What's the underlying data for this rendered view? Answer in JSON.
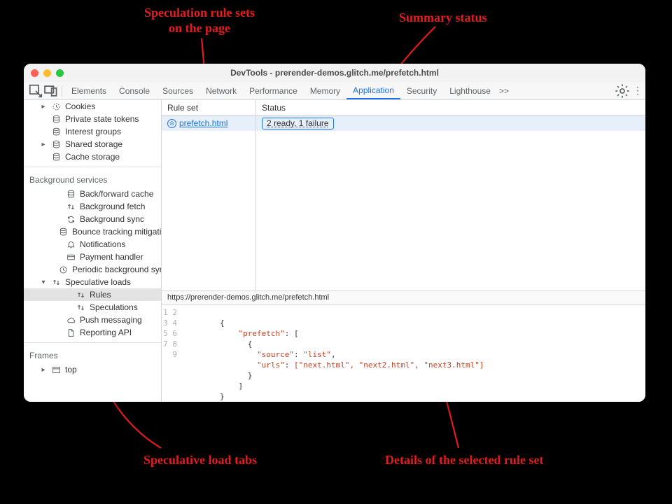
{
  "annotations": {
    "rulesets": "Speculation rule sets\non the page",
    "summary": "Summary status",
    "tabs": "Speculative load tabs",
    "details": "Details of the selected rule set"
  },
  "window": {
    "title": "DevTools - prerender-demos.glitch.me/prefetch.html"
  },
  "toolbar": {
    "tabs": [
      "Elements",
      "Console",
      "Sources",
      "Network",
      "Performance",
      "Memory",
      "Application",
      "Security",
      "Lighthouse"
    ],
    "activeTab": "Application",
    "overflow": ">>"
  },
  "sidebar": {
    "app_items": [
      {
        "caret": "▸",
        "icon": "clock-dashed-icon",
        "label": "Cookies"
      },
      {
        "caret": "",
        "icon": "database-icon",
        "label": "Private state tokens"
      },
      {
        "caret": "",
        "icon": "database-icon",
        "label": "Interest groups"
      },
      {
        "caret": "▸",
        "icon": "database-icon",
        "label": "Shared storage"
      },
      {
        "caret": "",
        "icon": "database-icon",
        "label": "Cache storage"
      }
    ],
    "bg_title": "Background services",
    "bg_items": [
      {
        "icon": "database-icon",
        "label": "Back/forward cache"
      },
      {
        "icon": "updown-icon",
        "label": "Background fetch"
      },
      {
        "icon": "sync-icon",
        "label": "Background sync"
      },
      {
        "icon": "database-icon",
        "label": "Bounce tracking mitigations"
      },
      {
        "icon": "bell-icon",
        "label": "Notifications"
      },
      {
        "icon": "card-icon",
        "label": "Payment handler"
      },
      {
        "icon": "clock-icon",
        "label": "Periodic background sync"
      }
    ],
    "spec": {
      "icon": "updown-icon",
      "label": "Speculative loads",
      "caret": "▾"
    },
    "spec_children": [
      {
        "icon": "updown-icon",
        "label": "Rules",
        "sel": true
      },
      {
        "icon": "updown-icon",
        "label": "Speculations"
      }
    ],
    "after_spec": [
      {
        "icon": "cloud-icon",
        "label": "Push messaging"
      },
      {
        "icon": "file-icon",
        "label": "Reporting API"
      }
    ],
    "frames_title": "Frames",
    "frames_items": [
      {
        "caret": "▸",
        "icon": "window-icon",
        "label": "top"
      }
    ]
  },
  "table": {
    "col1": "Rule set",
    "col2": "Status",
    "ruleset_link": "prefetch.html",
    "status_text": "2 ready, 1 failure",
    "url": "https://prerender-demos.glitch.me/prefetch.html"
  },
  "code": {
    "lines": 9,
    "json_pretty": {
      "key_prefetch": "\"prefetch\"",
      "key_source": "\"source\"",
      "val_source": "\"list\"",
      "key_urls": "\"urls\"",
      "urls_arr": "[\"next.html\", \"next2.html\", \"next3.html\"]"
    }
  }
}
